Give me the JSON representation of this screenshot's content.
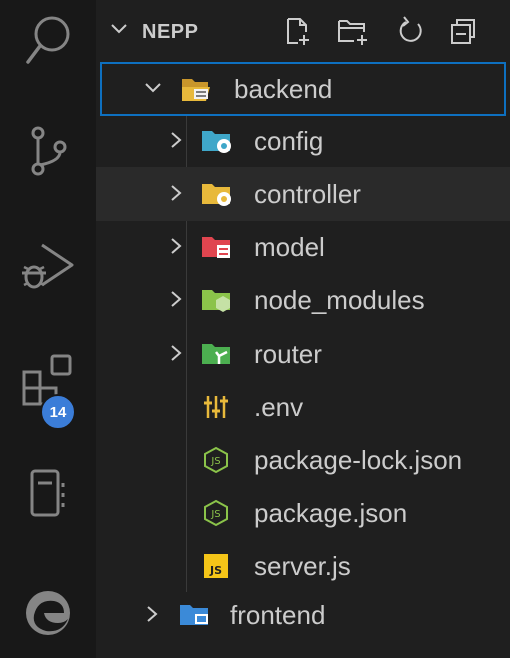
{
  "explorer": {
    "folder_name": "NEPP",
    "header_actions": [
      "new-file-icon",
      "new-folder-icon",
      "refresh-icon",
      "collapse-all-icon"
    ]
  },
  "activity_bar": {
    "items": [
      "search-icon",
      "source-control-icon",
      "run-debug-icon",
      "extensions-icon",
      "notebook-icon",
      "edge-icon"
    ],
    "extensions_badge": "14"
  },
  "tree": {
    "backend": "backend",
    "config": "config",
    "controller": "controller",
    "model": "model",
    "node_modules": "node_modules",
    "router": "router",
    "env": ".env",
    "package_lock": "package-lock.json",
    "package": "package.json",
    "server": "server.js",
    "frontend": "frontend"
  },
  "colors": {
    "background": "#1f1f1f",
    "activity_bar": "#181818",
    "selection_outline": "#0e70c0",
    "badge": "#3b7dd8",
    "folder_yellow": "#e8b93b",
    "config_blue": "#3fa7c9",
    "model_red": "#e0454f",
    "node_green": "#8bc34a",
    "router_green": "#4caf50",
    "frontend_blue": "#3b8ad8"
  }
}
